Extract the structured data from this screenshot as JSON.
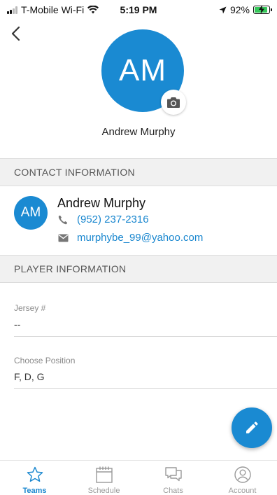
{
  "status_bar": {
    "carrier": "T-Mobile Wi-Fi",
    "time": "5:19 PM",
    "battery": "92%",
    "battery_level": 0.92
  },
  "profile": {
    "initials": "AM",
    "name": "Andrew Murphy"
  },
  "contact_section": {
    "title": "CONTACT INFORMATION",
    "initials": "AM",
    "name": "Andrew Murphy",
    "phone": "(952) 237-2316",
    "email": "murphybe_99@yahoo.com"
  },
  "player_section": {
    "title": "PLAYER INFORMATION",
    "fields": [
      {
        "label": "Jersey #",
        "value": "--"
      },
      {
        "label": "Choose Position",
        "value": "F, D, G"
      }
    ]
  },
  "tabs": [
    {
      "label": "Teams",
      "icon": "star-icon",
      "active": true
    },
    {
      "label": "Schedule",
      "icon": "calendar-icon",
      "active": false
    },
    {
      "label": "Chats",
      "icon": "chat-icon",
      "active": false
    },
    {
      "label": "Account",
      "icon": "account-icon",
      "active": false
    }
  ],
  "colors": {
    "accent": "#1a8ad2",
    "link": "#1a87cf",
    "section_bg": "#f1f1f1",
    "battery": "#35c759"
  }
}
